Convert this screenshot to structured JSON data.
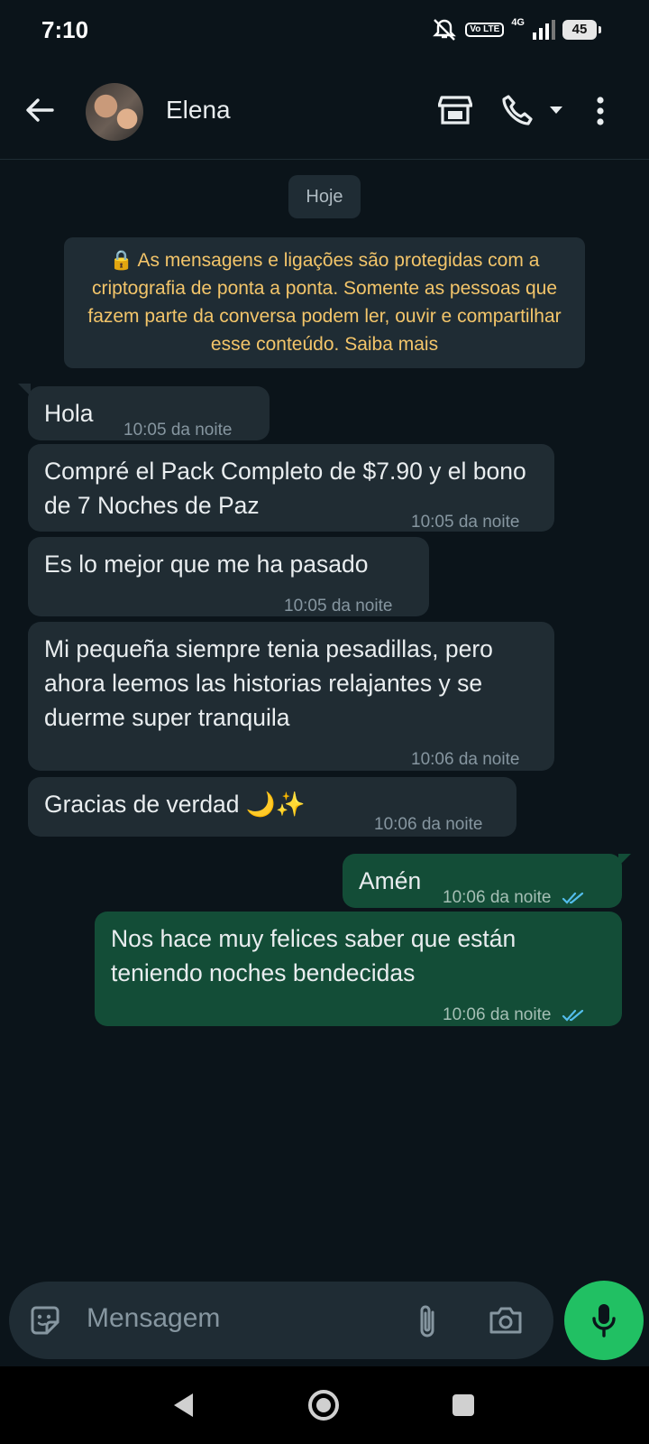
{
  "status_bar": {
    "time": "7:10",
    "volte": "Vo LTE",
    "network": "4G",
    "battery": "45",
    "icons": [
      "mute-icon",
      "signal-icon",
      "battery-icon"
    ]
  },
  "header": {
    "contact_name": "Elena",
    "icons": [
      "back-arrow-icon",
      "avatar",
      "store-icon",
      "call-icon",
      "dropdown-icon",
      "more-options-icon"
    ]
  },
  "chat": {
    "date_label": "Hoje",
    "encryption_notice": "🔒 As mensagens e ligações são protegidas com a criptografia de ponta a ponta. Somente as pessoas que fazem parte da conversa podem ler, ouvir e compartilhar esse conteúdo. Saiba mais",
    "messages": [
      {
        "direction": "in",
        "text": "Hola",
        "time": "10:05 da noite"
      },
      {
        "direction": "in",
        "text": "Compré el Pack Completo de $7.90 y el bono de 7 Noches de Paz",
        "time": "10:05 da noite"
      },
      {
        "direction": "in",
        "text": "Es lo mejor que me ha pasado",
        "time": "10:05 da noite"
      },
      {
        "direction": "in",
        "text": "Mi pequeña siempre tenia pesadillas, pero ahora leemos las historias relajantes y se duerme super tranquila",
        "time": "10:06 da noite"
      },
      {
        "direction": "in",
        "text": "Gracias de verdad 🌙✨",
        "time": "10:06 da noite"
      },
      {
        "direction": "out",
        "text": "Amén",
        "time": "10:06 da noite",
        "status": "read"
      },
      {
        "direction": "out",
        "text": "Nos hace muy felices saber que están teniendo noches bendecidas",
        "time": "10:06 da noite",
        "status": "read"
      }
    ]
  },
  "composer": {
    "placeholder": "Mensagem",
    "icons": [
      "sticker-icon",
      "attach-icon",
      "camera-icon",
      "mic-icon"
    ]
  },
  "colors": {
    "background": "#0b141a",
    "incoming_bubble": "#202c33",
    "outgoing_bubble": "#134d37",
    "accent_green": "#21c063",
    "encryption_text": "#f3c56a",
    "read_ticks": "#53bdeb"
  }
}
